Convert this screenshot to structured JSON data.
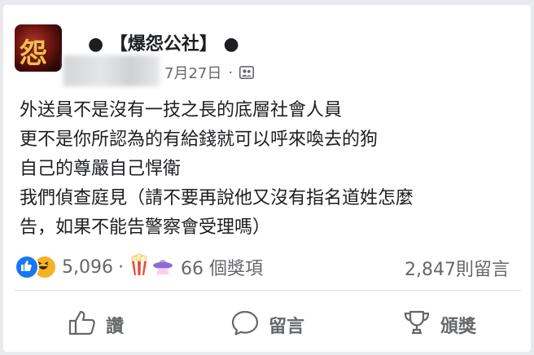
{
  "post": {
    "page_name": "● 【爆怨公社】 ●",
    "date": "7月27日",
    "dot": "·",
    "lines": [
      "外送員不是沒有一技之長的底層社會人員",
      "更不是你所認為的有給錢就可以呼來喚去的狗",
      "自己的尊嚴自己悍衛",
      "我們偵查庭見（請不要再說他又沒有指名道姓怎麼",
      "告，如果不能告警察會受理嗎）"
    ]
  },
  "stats": {
    "reaction_count": "5,096",
    "sep": "·",
    "awards_count": "66 個獎項",
    "comments": "2,847則留言"
  },
  "actions": {
    "like": "讚",
    "comment": "留言",
    "award": "頒獎"
  },
  "icons": {
    "audience": "group-icon",
    "like": "thumbs-up-icon",
    "comment": "speech-bubble-icon",
    "award": "trophy-icon"
  },
  "colors": {
    "like_blue": "#1877f2",
    "haha_yellow": "#f7b125",
    "secondary_text": "#65676b"
  }
}
